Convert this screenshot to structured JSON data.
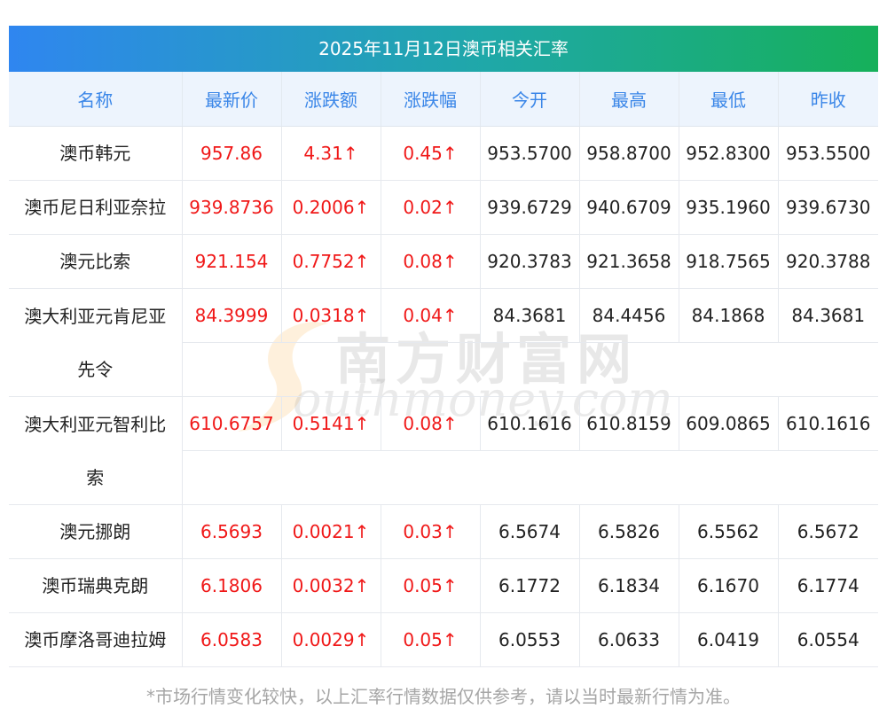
{
  "title": "2025年11月12日澳币相关汇率",
  "columns": [
    "名称",
    "最新价",
    "涨跌额",
    "涨跌幅",
    "今开",
    "最高",
    "最低",
    "昨收"
  ],
  "rows": [
    {
      "name": "澳币韩元",
      "latest": "957.86",
      "change": "4.31↑",
      "change_pct": "0.45↑",
      "open": "953.5700",
      "high": "958.8700",
      "low": "952.8300",
      "prev_close": "953.5500"
    },
    {
      "name": "澳币尼日利亚奈拉",
      "latest": "939.8736",
      "change": "0.2006↑",
      "change_pct": "0.02↑",
      "open": "939.6729",
      "high": "940.6709",
      "low": "935.1960",
      "prev_close": "939.6730"
    },
    {
      "name": "澳元比索",
      "latest": "921.154",
      "change": "0.7752↑",
      "change_pct": "0.08↑",
      "open": "920.3783",
      "high": "921.3658",
      "low": "918.7565",
      "prev_close": "920.3788"
    },
    {
      "name_line1": "澳大利亚元肯尼亚",
      "name_line2": "先令",
      "latest": "84.3999",
      "change": "0.0318↑",
      "change_pct": "0.04↑",
      "open": "84.3681",
      "high": "84.4456",
      "low": "84.1868",
      "prev_close": "84.3681"
    },
    {
      "name_line1": "澳大利亚元智利比",
      "name_line2": "索",
      "latest": "610.6757",
      "change": "0.5141↑",
      "change_pct": "0.08↑",
      "open": "610.1616",
      "high": "610.8159",
      "low": "609.0865",
      "prev_close": "610.1616"
    },
    {
      "name": "澳元挪朗",
      "latest": "6.5693",
      "change": "0.0021↑",
      "change_pct": "0.03↑",
      "open": "6.5674",
      "high": "6.5826",
      "low": "6.5562",
      "prev_close": "6.5672"
    },
    {
      "name": "澳币瑞典克朗",
      "latest": "6.1806",
      "change": "0.0032↑",
      "change_pct": "0.05↑",
      "open": "6.1772",
      "high": "6.1834",
      "low": "6.1670",
      "prev_close": "6.1774"
    },
    {
      "name": "澳币摩洛哥迪拉姆",
      "latest": "6.0583",
      "change": "0.0029↑",
      "change_pct": "0.05↑",
      "open": "6.0553",
      "high": "6.0633",
      "low": "6.0419",
      "prev_close": "6.0554"
    }
  ],
  "watermark": {
    "cn": "南方财富网",
    "en": "outhmoney.com"
  },
  "footer": "*市场行情变化较快，以上汇率行情数据仅供参考，请以当时最新行情为准。",
  "colors": {
    "header_gradient_start": "#2f86f0",
    "header_gradient_end": "#16b05a",
    "column_header_text": "#3a86e8",
    "up": "#f01818"
  }
}
